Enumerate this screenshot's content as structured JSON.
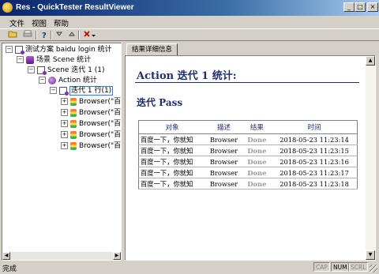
{
  "window": {
    "title": "Res - QuickTester ResultViewer",
    "min": "_",
    "max": "□",
    "close": "×"
  },
  "menu": [
    "文件",
    "视图",
    "帮助"
  ],
  "tree": {
    "root": "测试方案 baidu login 统计",
    "scene": "场景 Scene 统计",
    "scene_iter": "Scene 迭代 1 (1)",
    "action": "Action  统计",
    "action_iter": "迭代 1 行(1)",
    "browser_items": [
      "Browser(\"百度一",
      "Browser(\"百度一",
      "Browser(\"百度一",
      "Browser(\"百度一",
      "Browser(\"百度一"
    ]
  },
  "tab": {
    "label": "结果详细信息"
  },
  "report": {
    "title": "Action 迭代  1 统计:",
    "status": "迭代  Pass",
    "headers": {
      "object": "对象",
      "desc": "描述",
      "result": "结果",
      "time": "时间"
    },
    "rows": [
      {
        "object": "百度一下，你就知",
        "desc": "Browser",
        "result": "Done",
        "time": "2018-05-23 11:23:14"
      },
      {
        "object": "百度一下，你就知",
        "desc": "Browser",
        "result": "Done",
        "time": "2018-05-23 11:23:15"
      },
      {
        "object": "百度一下，你就知",
        "desc": "Browser",
        "result": "Done",
        "time": "2018-05-23 11:23:16"
      },
      {
        "object": "百度一下，你就知",
        "desc": "Browser",
        "result": "Done",
        "time": "2018-05-23 11:23:17"
      },
      {
        "object": "百度一下，你就知",
        "desc": "Browser",
        "result": "Done",
        "time": "2018-05-23 11:23:18"
      }
    ]
  },
  "statusbar": {
    "text": "完成",
    "cap": "CAP",
    "num": "NUM",
    "scrl": "SCRL"
  }
}
